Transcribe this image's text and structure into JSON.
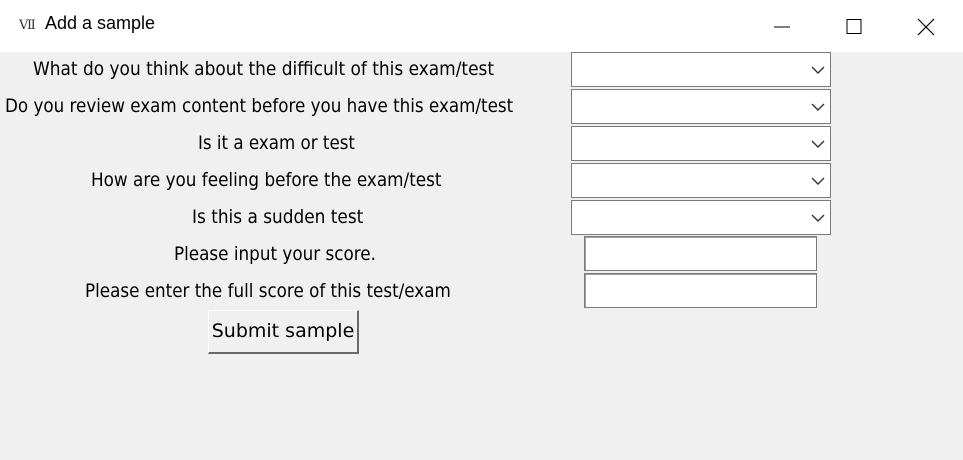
{
  "window": {
    "title": "Add a sample",
    "icon": "app-icon"
  },
  "form": {
    "questions": [
      {
        "label": "What do you think about the difficult of this exam/test",
        "value": ""
      },
      {
        "label": "Do you review exam content before you have this exam/test",
        "value": ""
      },
      {
        "label": "Is it a exam or test",
        "value": ""
      },
      {
        "label": "How are you feeling before the exam/test",
        "value": ""
      },
      {
        "label": "Is this a sudden test",
        "value": ""
      }
    ],
    "score_label": "Please input your score.",
    "score_value": "",
    "full_score_label": "Please enter the full score of this test/exam",
    "full_score_value": "",
    "submit_label": "Submit sample"
  }
}
